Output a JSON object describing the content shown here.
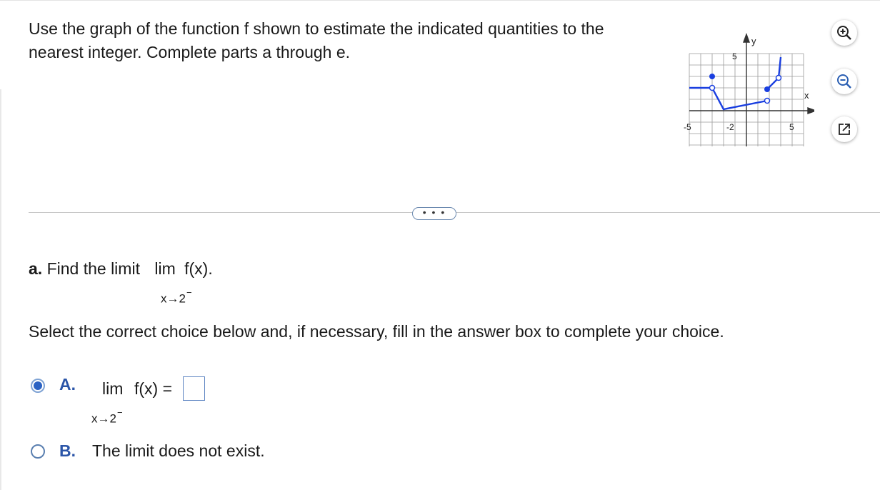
{
  "question": {
    "text": "Use the graph of the function f shown to estimate the indicated quantities to the nearest integer. Complete parts a through e."
  },
  "graph": {
    "y_axis_label": "y",
    "x_axis_label": "x",
    "y_tick_label": "5",
    "x_left_tick_label": "-5",
    "x_right_tick_label": "5",
    "y_bottom_tick_label": "-2",
    "curve_color": "#1a3fe0"
  },
  "toolbar": {
    "zoom_in_icon": "zoom-in-icon",
    "zoom_out_icon": "zoom-out-icon",
    "popout_icon": "popout-icon"
  },
  "more_button": {
    "label": "• • •"
  },
  "part_a": {
    "letter": "a.",
    "prompt": "Find the limit",
    "lim_word": "lim",
    "expr": "f(x).",
    "sub": "x→2",
    "sup": "−"
  },
  "instruction": "Select the correct choice below and, if necessary, fill in the answer box to complete your choice.",
  "choices": [
    {
      "letter": "A.",
      "lim_word": "lim",
      "expr": "f(x) =",
      "sub": "x→2",
      "sup": "−",
      "answer_value": "",
      "selected": true
    },
    {
      "letter": "B.",
      "text": "The limit does not exist.",
      "selected": false
    }
  ]
}
